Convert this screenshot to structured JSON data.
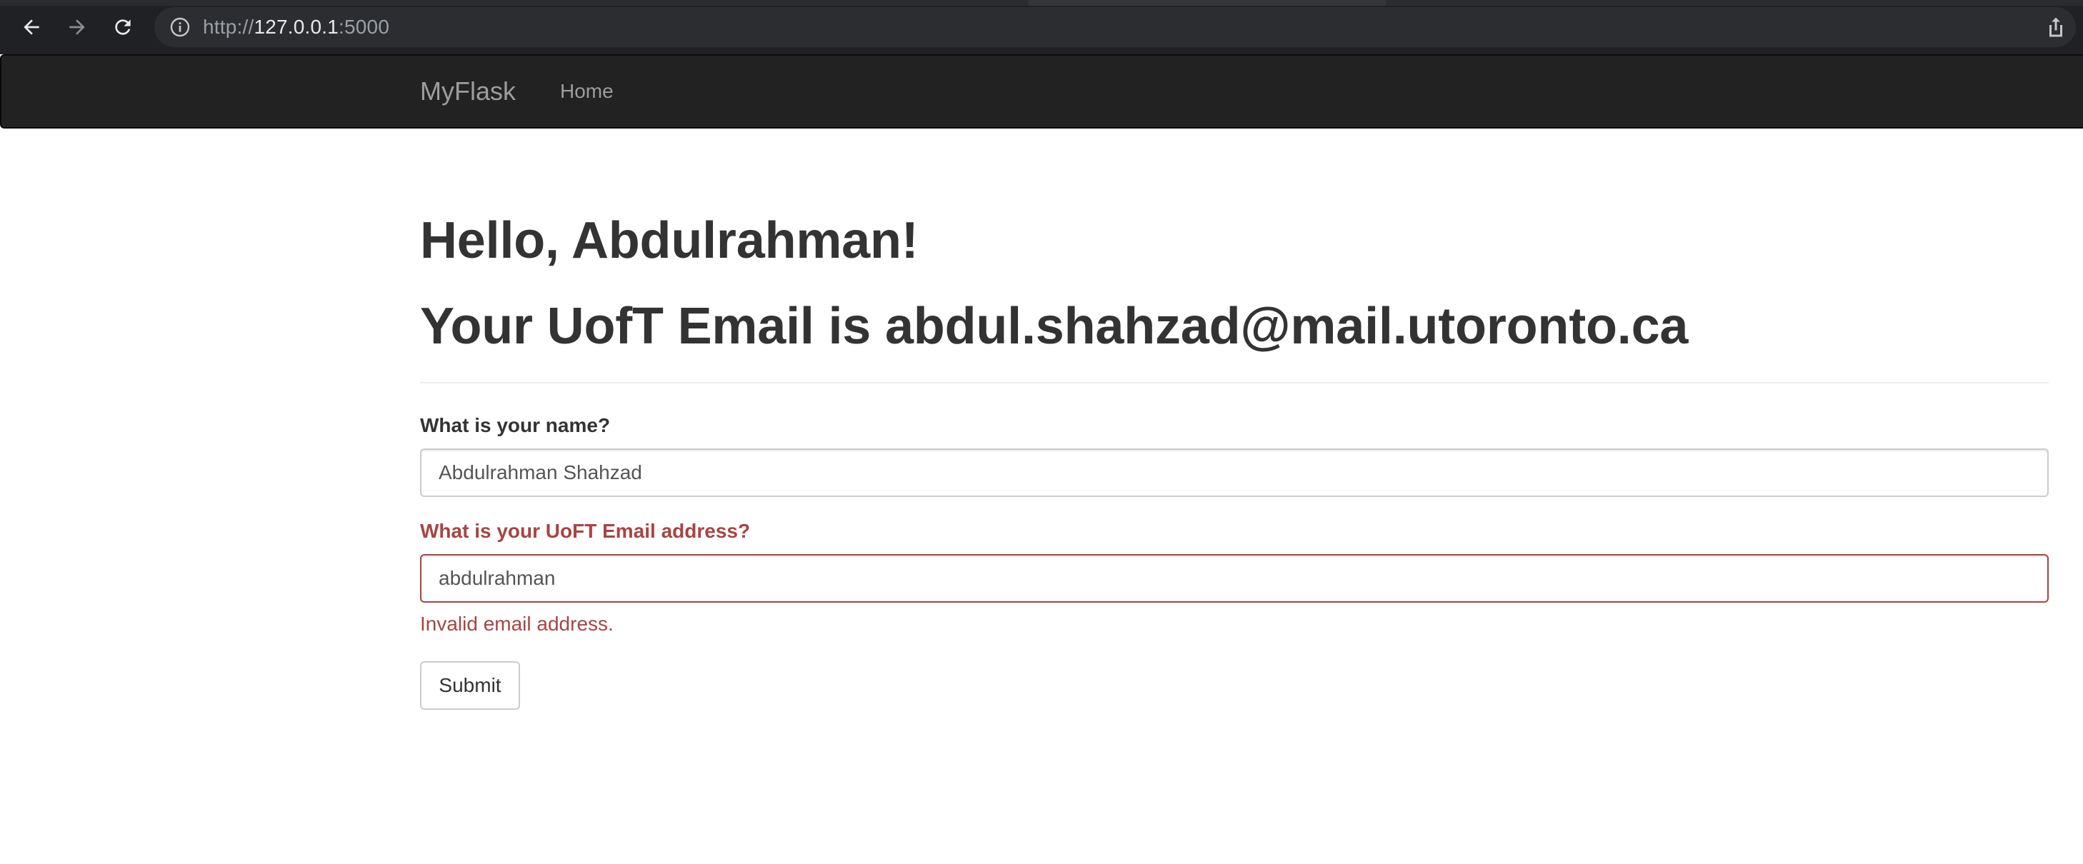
{
  "browser": {
    "url_scheme": "http://",
    "url_host": "127.0.0.1",
    "url_port": ":5000"
  },
  "navbar": {
    "brand": "MyFlask",
    "links": [
      {
        "label": "Home"
      }
    ]
  },
  "main": {
    "greeting": "Hello, Abdulrahman!",
    "email_line": "Your UofT Email is abdul.shahzad@mail.utoronto.ca",
    "form": {
      "name_label": "What is your name?",
      "name_value": "Abdulrahman Shahzad",
      "email_label": "What is your UoFT Email address?",
      "email_value": "abdulrahman",
      "email_error": "Invalid email address.",
      "submit_label": "Submit"
    }
  },
  "colors": {
    "navbar_bg": "#222222",
    "navbar_text": "#9d9d9d",
    "heading_text": "#333333",
    "error": "#a94442",
    "browser_bg": "#202124"
  },
  "icons": {
    "back": "arrow-left-icon",
    "forward": "arrow-right-icon",
    "reload": "reload-icon",
    "site_info": "info-icon",
    "share": "share-icon"
  }
}
